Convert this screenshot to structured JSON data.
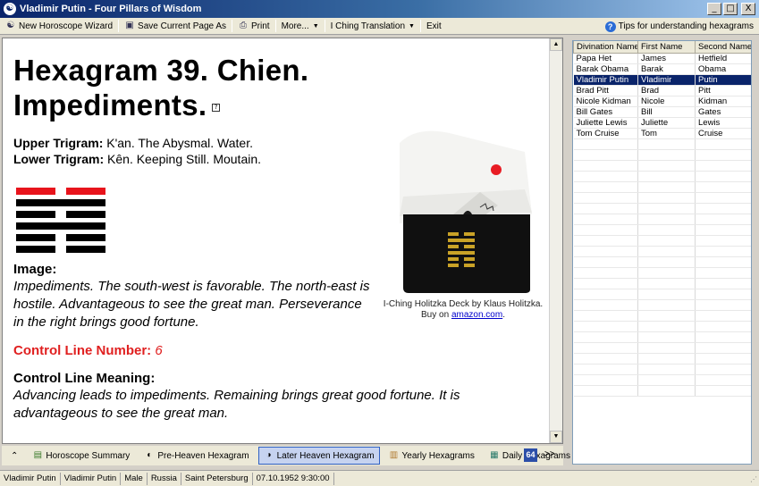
{
  "window": {
    "title": "Vladimir Putin - Four Pillars of Wisdom",
    "minimize": "_",
    "maximize": "□",
    "close": "X"
  },
  "toolbar": {
    "new_wizard": "New Horoscope Wizard",
    "save_page": "Save Current Page As",
    "print": "Print",
    "more": "More...",
    "iching": "I Ching Translation",
    "exit": "Exit",
    "tips": "Tips for understanding hexagrams"
  },
  "hexagram": {
    "title_line1": "Hexagram 39. Chien.",
    "title_line2": "Impediments.",
    "upper_label": "Upper Trigram:",
    "upper_value": " K'an. The Abysmal. Water.",
    "lower_label": "Lower Trigram:",
    "lower_value": " Kên. Keeping Still. Moutain.",
    "lines_top_to_bottom": [
      "broken-red",
      "solid",
      "broken",
      "solid",
      "broken",
      "broken"
    ],
    "line_colors": {
      "red": "#e8141c",
      "black": "#000000"
    },
    "image_head": "Image:",
    "image_text": "Impediments. The south-west is favorable. The north-east is hostile. Advantageous to see the great man. Perseverance in the right brings good fortune.",
    "control_line_label": "Control Line Number:",
    "control_line_number": "6",
    "control_meaning_head": "Control Line Meaning:",
    "control_meaning_text": "Advancing leads to impediments. Remaining brings great good fortune. It is advantageous to see the great man."
  },
  "card": {
    "caption_line1": "I-Ching Holitzka Deck by Klaus Holitzka.",
    "caption_buy": "Buy on ",
    "caption_link": "amazon.com",
    "caption_end": "."
  },
  "tabs": {
    "summary": "Horoscope Summary",
    "pre_heaven": "Pre-Heaven Hexagram",
    "later_heaven": "Later Heaven Hexagram",
    "yearly": "Yearly Hexagrams",
    "daily": "Daily Hexagrams",
    "badge": "64",
    "more": ">>",
    "collapse": "⌃"
  },
  "people_table": {
    "headers": [
      "Divination Name",
      "First Name",
      "Second Name"
    ],
    "rows": [
      [
        "Papa Het",
        "James",
        "Hetfield"
      ],
      [
        "Barak Obama",
        "Barak",
        "Obama"
      ],
      [
        "Vladimir Putin",
        "Vladimir",
        "Putin"
      ],
      [
        "Brad Pitt",
        "Brad",
        "Pitt"
      ],
      [
        "Nicole Kidman",
        "Nicole",
        "Kidman"
      ],
      [
        "Bill Gates",
        "Bill",
        "Gates"
      ],
      [
        "Juliette Lewis",
        "Juliette",
        "Lewis"
      ],
      [
        "Tom Cruise",
        "Tom",
        "Cruise"
      ]
    ],
    "selected_index": 2
  },
  "status": {
    "divination_name": "Vladimir Putin",
    "full_name": "Vladimir Putin",
    "gender": "Male",
    "country": "Russia",
    "city": "Saint Petersburg",
    "birth": "07.10.1952 9:30:00"
  }
}
